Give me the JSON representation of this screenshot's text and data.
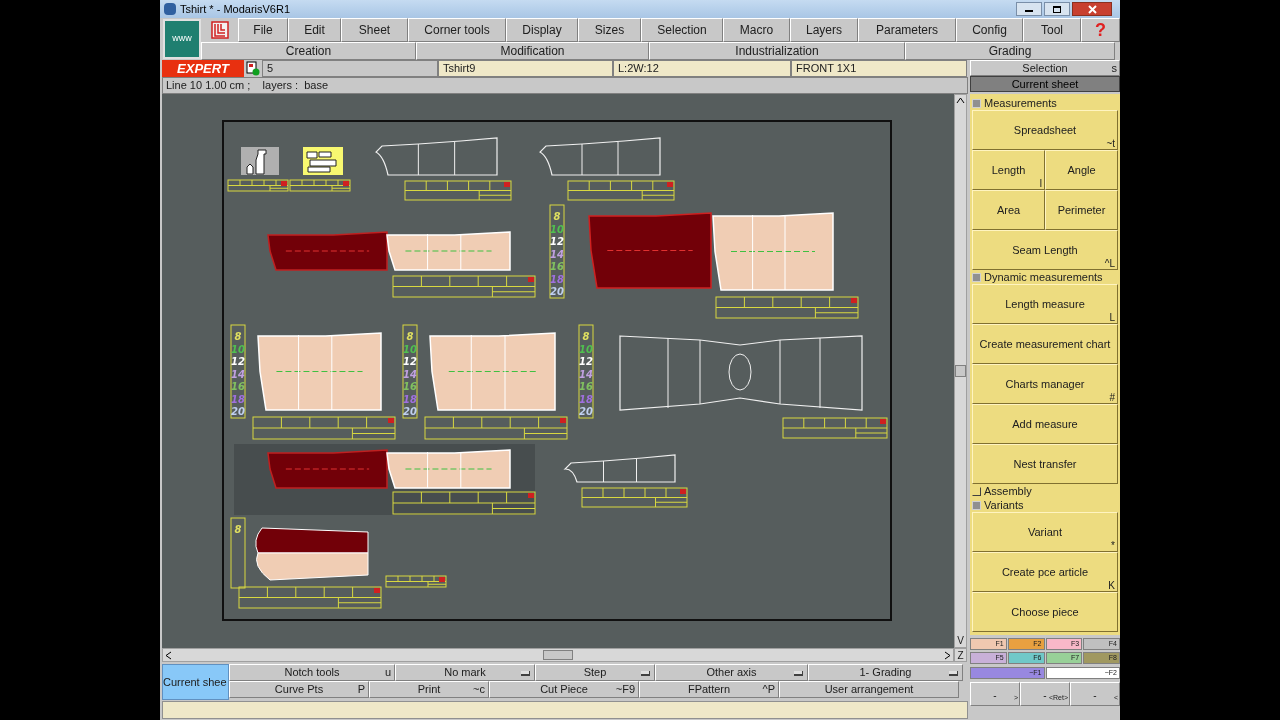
{
  "window": {
    "title": "Tshirt * - ModarisV6R1"
  },
  "menu": [
    {
      "label": "File"
    },
    {
      "label": "Edit"
    },
    {
      "label": "Sheet"
    },
    {
      "label": "Corner tools"
    },
    {
      "label": "Display"
    },
    {
      "label": "Sizes"
    },
    {
      "label": "Selection"
    },
    {
      "label": "Macro"
    },
    {
      "label": "Layers"
    },
    {
      "label": "Parameters"
    },
    {
      "label": "Config"
    },
    {
      "label": "Tool"
    }
  ],
  "help": "?",
  "www": "www",
  "submenu": [
    {
      "label": "Creation"
    },
    {
      "label": "Modification"
    },
    {
      "label": "Industrialization"
    },
    {
      "label": "Grading"
    }
  ],
  "mode_badge": "EXPERT",
  "info_fields": [
    "5",
    "Tshirt9",
    "L:2W:12",
    "FRONT 1X1"
  ],
  "status_line": "Line 10 1.00 cm ;    layers :  base",
  "right_tabs": [
    {
      "label": "Selection",
      "shortcut": "s",
      "selected": false
    },
    {
      "label": "Current sheet",
      "selected": true
    }
  ],
  "right_panel": [
    {
      "kind": "section",
      "label": "Measurements",
      "checked": true
    },
    {
      "kind": "button",
      "label": "Spreadsheet",
      "shortcut": "~t"
    },
    {
      "kind": "pair",
      "buttons": [
        {
          "label": "Length",
          "shortcut": "l"
        },
        {
          "label": "Angle"
        }
      ]
    },
    {
      "kind": "pair",
      "buttons": [
        {
          "label": "Area"
        },
        {
          "label": "Perimeter"
        }
      ]
    },
    {
      "kind": "button",
      "label": "Seam Length",
      "shortcut": "^L"
    },
    {
      "kind": "section",
      "label": "Dynamic measurements",
      "checked": true
    },
    {
      "kind": "button",
      "label": "Length measure",
      "shortcut": "L"
    },
    {
      "kind": "button",
      "label": "Create measurement chart"
    },
    {
      "kind": "button",
      "label": "Charts manager",
      "shortcut": "#"
    },
    {
      "kind": "button",
      "label": "Add measure"
    },
    {
      "kind": "button",
      "label": "Nest transfer"
    },
    {
      "kind": "section",
      "label": "Assembly",
      "checked": false
    },
    {
      "kind": "section",
      "label": "Variants",
      "checked": true
    },
    {
      "kind": "button",
      "label": "Variant",
      "shortcut": "*"
    },
    {
      "kind": "button",
      "label": "Create pce article",
      "shortcut": "K"
    },
    {
      "kind": "button",
      "label": "Choose piece"
    }
  ],
  "swatches": [
    {
      "label": "F1",
      "color": "#f0c8b0"
    },
    {
      "label": "F2",
      "color": "#e8a040"
    },
    {
      "label": "F3",
      "color": "#f8b8c8"
    },
    {
      "label": "F4",
      "color": "#c0c0c0"
    },
    {
      "label": "F5",
      "color": "#c8b0d8"
    },
    {
      "label": "F6",
      "color": "#70c8c8"
    },
    {
      "label": "F7",
      "color": "#98d098"
    },
    {
      "label": "F8",
      "color": "#a09860"
    }
  ],
  "wide_swatches": [
    {
      "label": "~F1",
      "color": "#9888e0"
    },
    {
      "label": "~F2",
      "color": "#ffffff"
    }
  ],
  "nav_buttons": [
    {
      "label": "-",
      "shortcut": ">"
    },
    {
      "label": "-",
      "shortcut": "<Ret>"
    },
    {
      "label": "-",
      "shortcut": "<"
    }
  ],
  "size_scales": [
    {
      "sizes": [
        {
          "label": "8",
          "color": "#e0e060"
        },
        {
          "label": "10",
          "color": "#50c050"
        },
        {
          "label": "12",
          "color": "#ffffff"
        },
        {
          "label": "14",
          "color": "#c0a0e0"
        },
        {
          "label": "16",
          "color": "#80c060"
        },
        {
          "label": "18",
          "color": "#a070e0"
        },
        {
          "label": "20",
          "color": "#c0d0f0"
        }
      ]
    },
    {
      "sizes": [
        {
          "label": "8",
          "color": "#e0e060"
        },
        {
          "label": "10",
          "color": "#50c050"
        },
        {
          "label": "12",
          "color": "#ffffff"
        },
        {
          "label": "14",
          "color": "#c0a0e0"
        },
        {
          "label": "16",
          "color": "#80c060"
        },
        {
          "label": "18",
          "color": "#a070e0"
        },
        {
          "label": "20",
          "color": "#c0d0f0"
        }
      ]
    },
    {
      "sizes": [
        {
          "label": "8",
          "color": "#e0e060"
        },
        {
          "label": "10",
          "color": "#50c050"
        },
        {
          "label": "12",
          "color": "#ffffff"
        },
        {
          "label": "14",
          "color": "#c0a0e0"
        },
        {
          "label": "16",
          "color": "#80c060"
        },
        {
          "label": "18",
          "color": "#a070e0"
        },
        {
          "label": "20",
          "color": "#c0d0f0"
        }
      ]
    },
    {
      "sizes": [
        {
          "label": "8",
          "color": "#e0e060"
        },
        {
          "label": "10",
          "color": "#50c050"
        },
        {
          "label": "12",
          "color": "#ffffff"
        },
        {
          "label": "14",
          "color": "#c0a0e0"
        },
        {
          "label": "16",
          "color": "#80c060"
        },
        {
          "label": "18",
          "color": "#a070e0"
        },
        {
          "label": "20",
          "color": "#c0d0f0"
        }
      ]
    },
    {
      "sizes": [
        {
          "label": "8",
          "color": "#e0e060"
        }
      ]
    }
  ],
  "scroll_letters": {
    "down": "V",
    "zoom": "Z"
  },
  "current_sheet_tab": "Current shee",
  "bottom_tools": [
    [
      {
        "label": "Notch tools",
        "shortcut": "u",
        "kind": "key"
      },
      {
        "label": "No mark",
        "kind": "dropdown"
      },
      {
        "label": "Step",
        "kind": "dropdown"
      },
      {
        "label": "Other axis",
        "kind": "dropdown"
      },
      {
        "label": "1- Grading",
        "kind": "dropdown"
      }
    ],
    [
      {
        "label": "Curve Pts",
        "shortcut": "P",
        "kind": "key"
      },
      {
        "label": "Print",
        "shortcut": "~c",
        "kind": "key"
      },
      {
        "label": "Cut Piece",
        "shortcut": "~F9",
        "kind": "key"
      },
      {
        "label": "FPattern",
        "shortcut": "^P",
        "kind": "key"
      },
      {
        "label": "User arrangement",
        "kind": "key"
      }
    ]
  ]
}
